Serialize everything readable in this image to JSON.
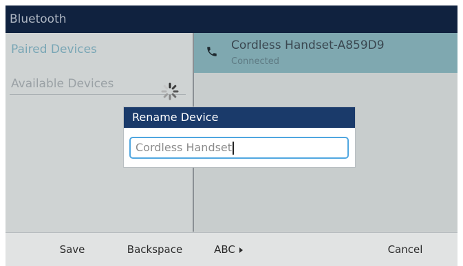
{
  "window": {
    "title": "Bluetooth"
  },
  "nav": {
    "items": [
      {
        "label": "Paired Devices",
        "selected": true
      },
      {
        "label": "Available Devices",
        "selected": false
      }
    ],
    "spinner_icon": "loading-spinner-icon"
  },
  "devices": [
    {
      "name": "Cordless Handset-A859D9",
      "status": "Connected",
      "icon": "phone-icon"
    }
  ],
  "dialog": {
    "title": "Rename Device",
    "input_value": "Cordless Handset"
  },
  "softkeys": {
    "save": "Save",
    "backspace": "Backspace",
    "abc": "ABC",
    "cancel": "Cancel"
  },
  "colors": {
    "title_bar": "#10223f",
    "dialog_header": "#1a3a6a",
    "selected_row": "#7fa8b0",
    "input_focus_border": "#4fa6e0"
  }
}
